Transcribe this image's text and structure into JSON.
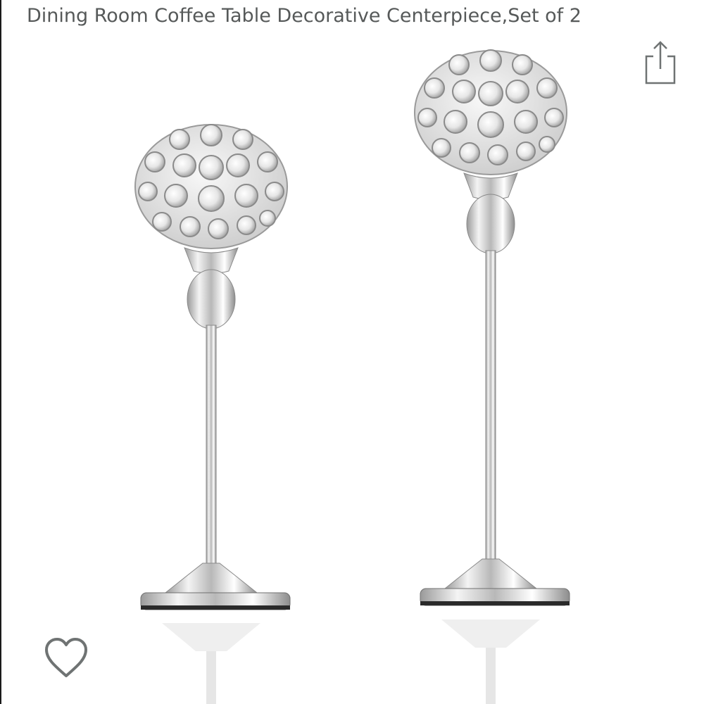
{
  "product": {
    "title": "Dining Room Coffee Table Decorative Centerpiece,Set of 2"
  },
  "icons": {
    "share": "share-icon",
    "favorite": "heart-outline-icon"
  },
  "colors": {
    "title_text": "#565959",
    "icon_stroke": "#6f7373"
  }
}
